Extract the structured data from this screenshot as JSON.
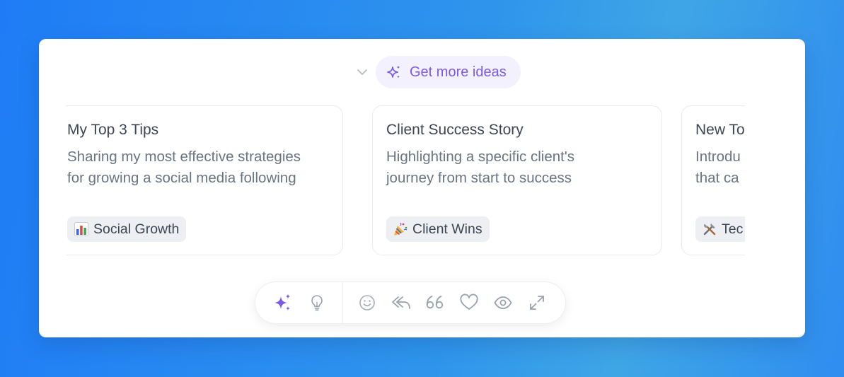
{
  "header": {
    "collapse_icon": "chevron-down-icon",
    "ideas_button": {
      "icon": "sparkles-icon",
      "label": "Get more ideas",
      "color": "#7b5ae6",
      "background": "#f4f1fe"
    }
  },
  "cards": [
    {
      "title": "My Top 3 Tips",
      "description_lines": [
        "Sharing my most effective strategies",
        "for growing a social media following"
      ],
      "tag": {
        "emoji": "bar-chart-icon",
        "label": "Social Growth"
      }
    },
    {
      "title": "Client Success Story",
      "description_lines": [
        "Highlighting a specific client's",
        "journey from start to success"
      ],
      "tag": {
        "emoji": "party-popper-icon",
        "label": "Client Wins"
      }
    },
    {
      "title": "New To",
      "description_lines": [
        "Introdu",
        "that ca"
      ],
      "tag": {
        "emoji": "tools-icon",
        "label": "Tec"
      }
    }
  ],
  "toolbar": {
    "buttons": [
      {
        "icon": "sparkles-icon",
        "active": true
      },
      {
        "icon": "lightbulb-icon",
        "active": false
      },
      {
        "icon": "smiley-icon",
        "active": false
      },
      {
        "icon": "reply-icon",
        "active": false
      },
      {
        "icon": "quote-icon",
        "active": false
      },
      {
        "icon": "heart-icon",
        "active": false
      },
      {
        "icon": "eye-icon",
        "active": false
      },
      {
        "icon": "expand-icon",
        "active": false
      }
    ]
  },
  "colors": {
    "accent": "#7b5ae6",
    "icon_gray": "#9aa1ab",
    "text_dark": "#3c4654",
    "text_muted": "#6a7482"
  }
}
